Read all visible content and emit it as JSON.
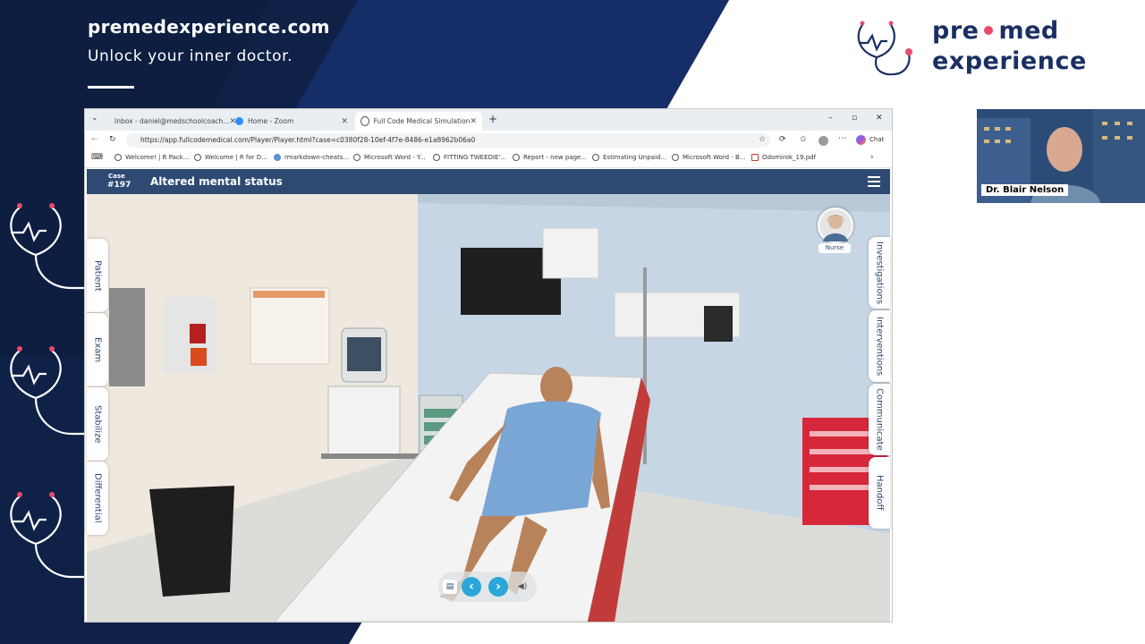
{
  "slide": {
    "url": "premedexperience.com",
    "tagline": "Unlock your inner doctor.",
    "logo_word1": "pre",
    "logo_word2": "med",
    "logo_word3": "experience",
    "colors": {
      "navy": "#0f2147",
      "accent": "#e84a6a",
      "app_header": "#2e4a72",
      "button": "#2aa6d8"
    }
  },
  "browser": {
    "tabs": [
      {
        "label": "Inbox - daniel@medschoolcoach...",
        "icon": "gmail-icon",
        "active": false
      },
      {
        "label": "Home - Zoom",
        "icon": "zoom-icon",
        "active": false
      },
      {
        "label": "Full Code Medical Simulation",
        "icon": "globe-icon",
        "active": true
      }
    ],
    "url": "https://app.fullcodemedical.com/Player/Player.html?case=c0380f28-10ef-4f7e-8486-e1a8962b06a0",
    "copilot_label": "Chat",
    "bookmarks": [
      "Welcome! | R Pack...",
      "Welcome | R for D...",
      "rmarkdown-cheats...",
      "Microsoft Word - Y...",
      "FITTING TWEEDIE'...",
      "Report - new page...",
      "Estimating Unpaid...",
      "Microsoft Word - B...",
      "Odomirok_19.pdf"
    ]
  },
  "app": {
    "case_label": "Case",
    "case_number": "#197",
    "case_title": "Altered mental status",
    "left_tabs": [
      "Patient",
      "Exam",
      "Stabilize",
      "Differential"
    ],
    "right_tabs": [
      "Investigations",
      "Interventions",
      "Communicate",
      "Handoff"
    ],
    "nurse_label": "Nurse"
  },
  "webcam": {
    "name": "Dr. Blair Nelson"
  }
}
